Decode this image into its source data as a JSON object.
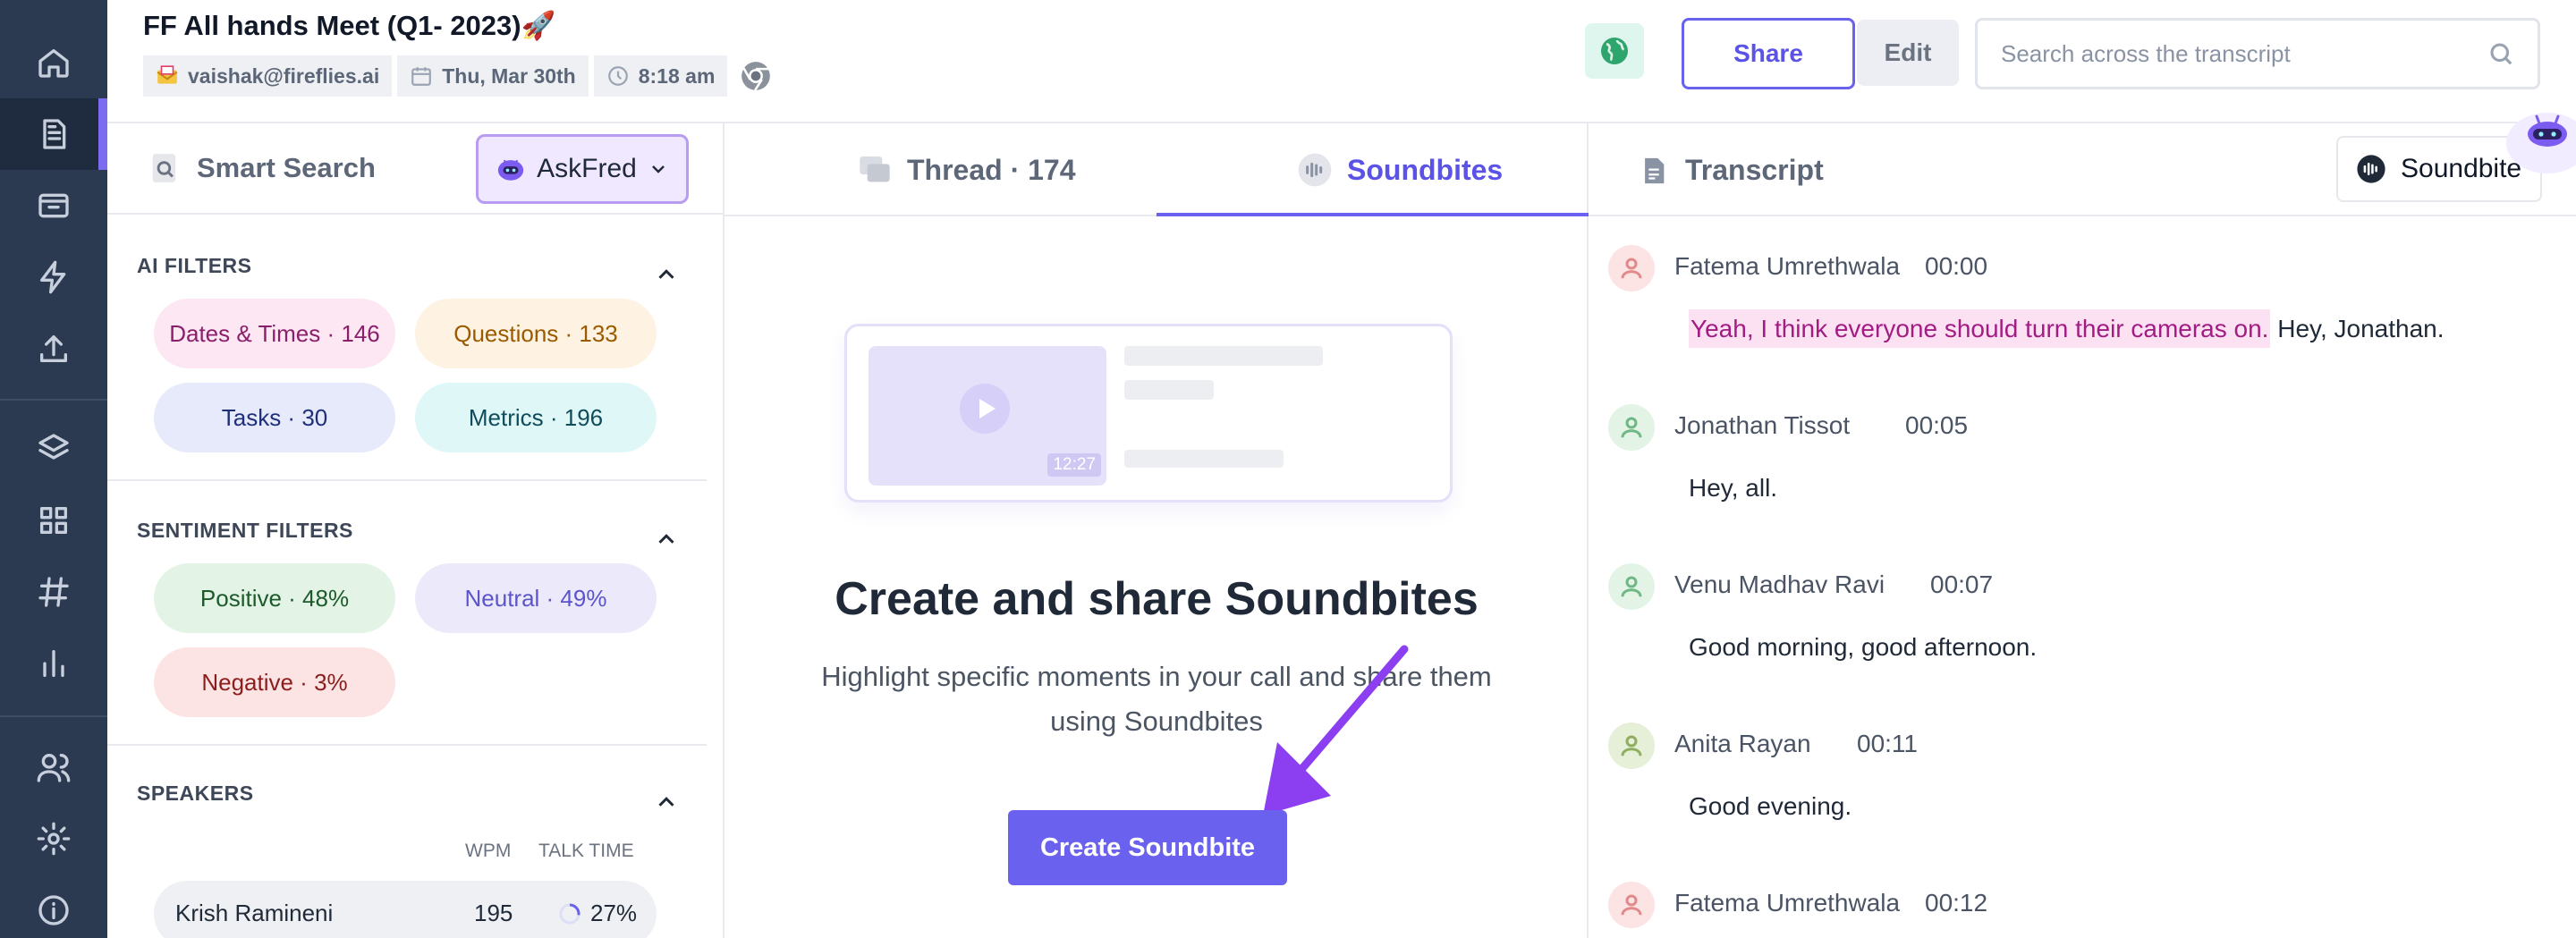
{
  "header": {
    "title": "FF All hands Meet (Q1- 2023)🚀",
    "email": "vaishak@fireflies.ai",
    "date": "Thu, Mar 30th",
    "time": "8:18 am",
    "share_label": "Share",
    "edit_label": "Edit",
    "search_placeholder": "Search across the transcript"
  },
  "left_panel": {
    "smart_search_label": "Smart Search",
    "askfred_label": "AskFred",
    "ai_filters": {
      "title": "AI FILTERS",
      "chips": [
        "Dates & Times · 146",
        "Questions · 133",
        "Tasks · 30",
        "Metrics · 196"
      ]
    },
    "sentiment_filters": {
      "title": "SENTIMENT FILTERS",
      "chips": [
        "Positive · 48%",
        "Neutral · 49%",
        "Negative · 3%"
      ]
    },
    "speakers": {
      "title": "SPEAKERS",
      "col_wpm": "WPM",
      "col_talk": "TALK TIME",
      "rows": [
        {
          "name": "Krish Ramineni",
          "wpm": "195",
          "talk_time": "27%",
          "talk_fraction": 0.27
        }
      ]
    }
  },
  "center_panel": {
    "tabs": [
      {
        "label": "Thread · 174",
        "active": false
      },
      {
        "label": "Soundbites",
        "active": true
      }
    ],
    "illustration_time": "12:27",
    "cta_title": "Create and share Soundbites",
    "cta_description": "Highlight specific moments in your call and share them using Soundbites",
    "cta_button": "Create Soundbite"
  },
  "right_panel": {
    "title": "Transcript",
    "soundbite_button": "Soundbite",
    "utterances": [
      {
        "speaker": "Fatema Umrethwala",
        "time": "00:00",
        "highlight": "Yeah, I think everyone should turn their cameras on.",
        "text": " Hey, Jonathan."
      },
      {
        "speaker": "Jonathan Tissot",
        "time": "00:05",
        "text": "Hey, all."
      },
      {
        "speaker": "Venu Madhav Ravi",
        "time": "00:07",
        "text": "Good morning, good afternoon."
      },
      {
        "speaker": "Anita Rayan",
        "time": "00:11",
        "text": "Good evening."
      },
      {
        "speaker": "Fatema Umrethwala",
        "time": "00:12",
        "text": ""
      }
    ]
  },
  "colors": {
    "rail_bg": "#2b3a51",
    "accent": "#6a62ee",
    "highlight_bg": "#fbe1f2",
    "highlight_text": "#a21c84",
    "chip_dates": "#fce7f3",
    "chip_questions": "#fef3e2",
    "chip_tasks": "#e7eafb",
    "chip_metrics": "#e0f7f7",
    "chip_positive": "#e3f4e6",
    "chip_neutral": "#ece9fb",
    "chip_negative": "#fde4e4"
  },
  "icons": [
    "home-icon",
    "notes-icon",
    "meetings-icon",
    "bolt-icon",
    "upload-icon",
    "layers-icon",
    "apps-icon",
    "hashtag-icon",
    "analytics-icon",
    "team-icon",
    "settings-icon",
    "info-icon",
    "chrome-icon",
    "globe-icon",
    "search-icon",
    "robot-icon",
    "thread-icon",
    "soundbite-icon",
    "document-icon",
    "user-icon"
  ]
}
